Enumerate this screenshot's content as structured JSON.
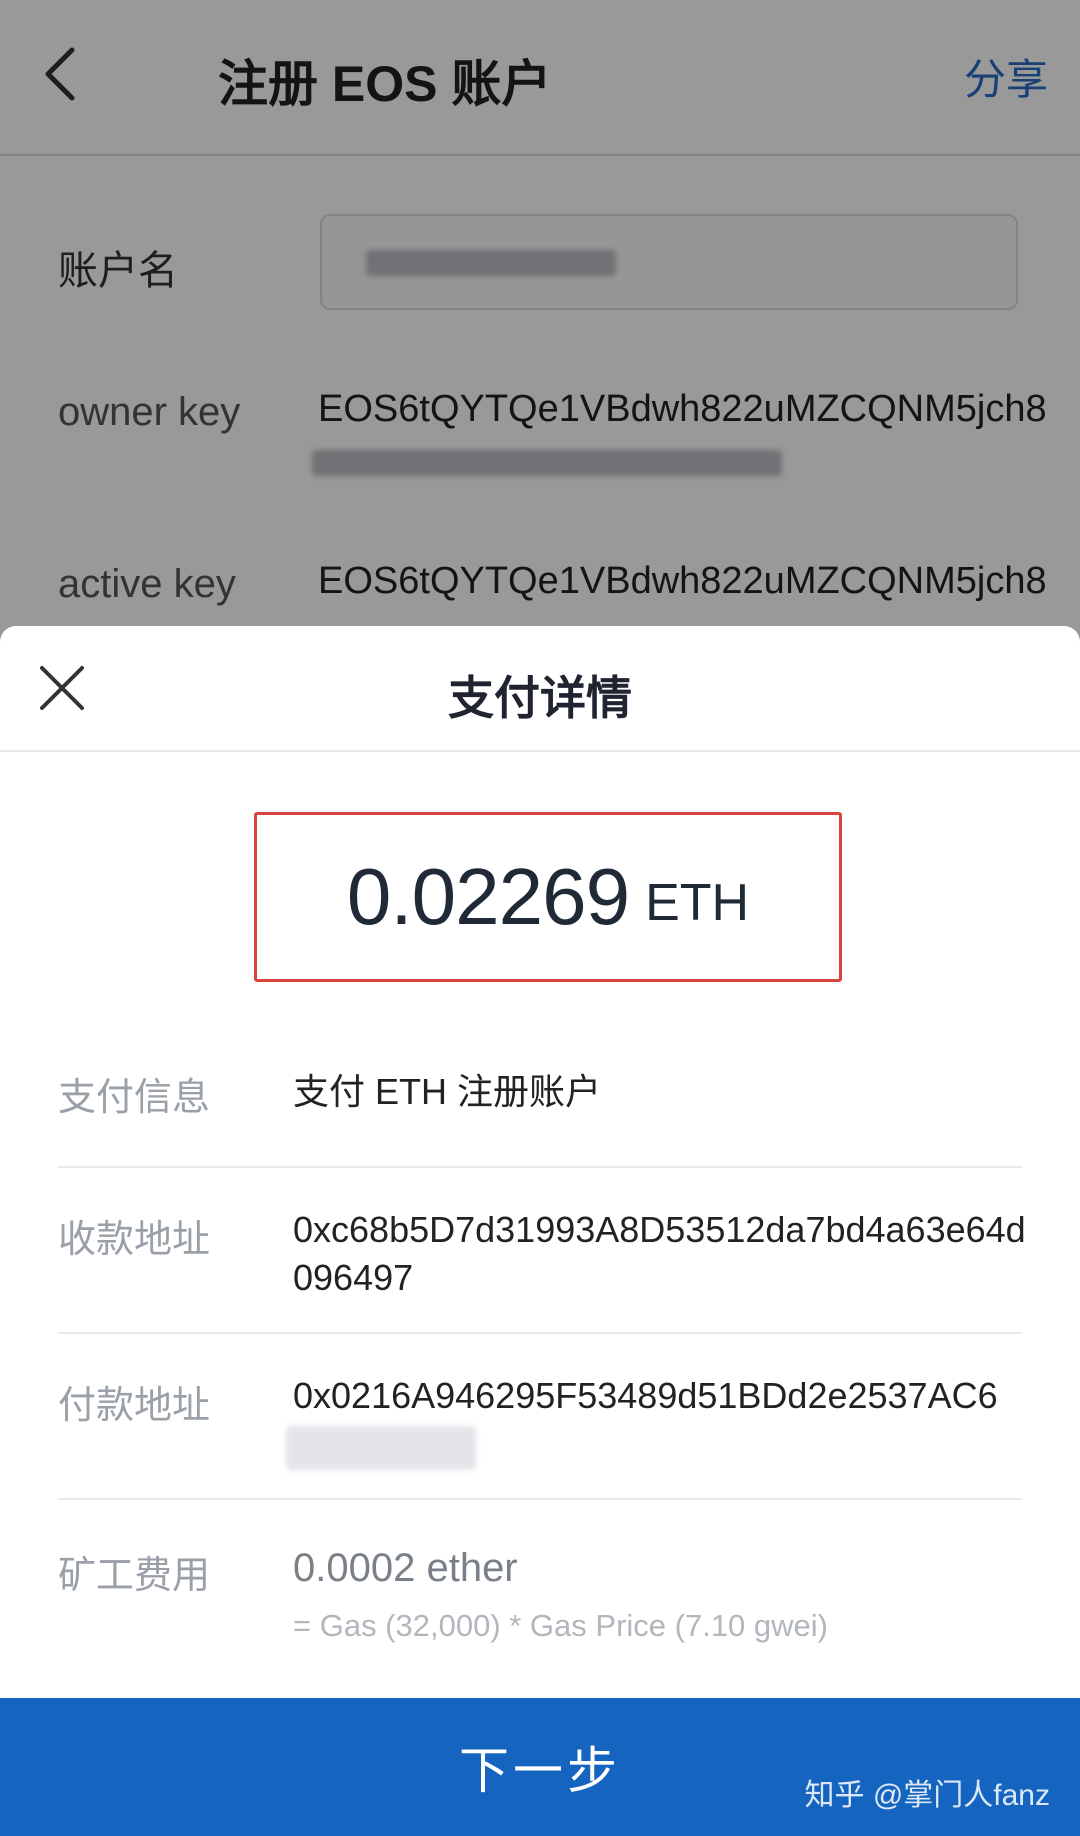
{
  "nav": {
    "title": "注册 EOS 账户",
    "share_label": "分享"
  },
  "form": {
    "account_name_label": "账户名",
    "owner_key_label": "owner key",
    "owner_key_value": "EOS6tQYTQe1VBdwh822uMZCQNM5jch8",
    "active_key_label": "active key",
    "active_key_value": "EOS6tQYTQe1VBdwh822uMZCQNM5jch8"
  },
  "sheet": {
    "title": "支付详情",
    "amount": "0.02269",
    "unit": "ETH",
    "rows": [
      {
        "label": "支付信息",
        "value": "支付 ETH 注册账户"
      },
      {
        "label": "收款地址",
        "value": "0xc68b5D7d31993A8D53512da7bd4a63e64d096497"
      },
      {
        "label": "付款地址",
        "value": "0x0216A946295F53489d51BDd2e2537AC6"
      },
      {
        "label": "矿工费用",
        "value": "0.0002 ether",
        "sub": "= Gas (32,000) * Gas Price (7.10 gwei)"
      }
    ],
    "next_label": "下一步"
  },
  "watermark": "知乎 @掌门人fanz",
  "colors": {
    "primary": "#1565c0",
    "highlight_border": "#d9453c",
    "share_link": "#2b6bc2"
  }
}
